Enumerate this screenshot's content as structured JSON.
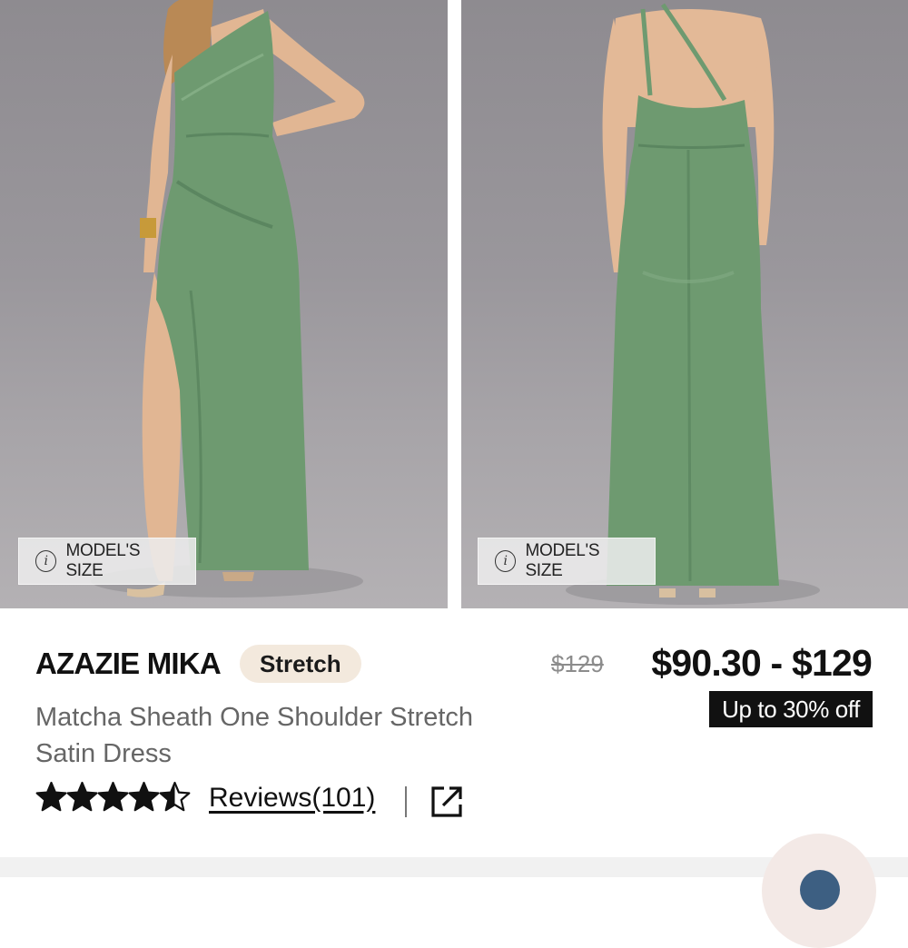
{
  "images": {
    "front": {
      "model_size_label": "MODEL'S SIZE",
      "dress_color": "#6e9a70"
    },
    "back": {
      "model_size_label": "MODEL'S SIZE",
      "dress_color": "#6e9a70"
    }
  },
  "product": {
    "brand": "AZAZIE MIKA",
    "tag": "Stretch",
    "name": "Matcha Sheath One Shoulder Stretch Satin Dress",
    "original_price": "$129",
    "price_range": "$90.30 - $129",
    "discount": "Up to 30% off",
    "rating": 4.5,
    "rating_max": 5,
    "reviews_label": "Reviews(101)"
  },
  "icons": {
    "info": "info-icon",
    "share": "share-external-icon",
    "star": "star-icon"
  },
  "colors": {
    "accent_badge_bg": "#f3e9dd",
    "discount_bg": "#111111",
    "chat_button": "#3d5f82"
  }
}
